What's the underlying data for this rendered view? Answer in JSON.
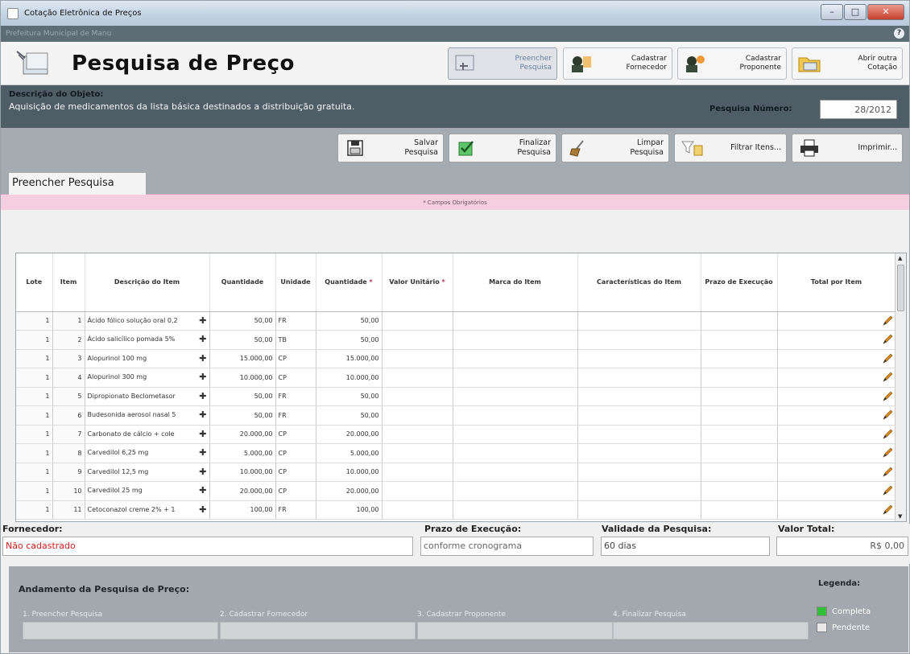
{
  "window": {
    "title": "Cotação Eletrônica de Preços",
    "org": "Prefeitura Municipal de Manu"
  },
  "header": {
    "title": "Pesquisa de Preço",
    "buttons": [
      {
        "l1": "Preencher",
        "l2": "Pesquisa"
      },
      {
        "l1": "Cadastrar",
        "l2": "Fornecedor"
      },
      {
        "l1": "Cadastrar",
        "l2": "Proponente"
      },
      {
        "l1": "Abrir outra",
        "l2": "Cotação"
      }
    ]
  },
  "description": {
    "label": "Descrição do Objeto:",
    "value": "Aquisição de medicamentos da lista básica destinados a distribuição gratuita.",
    "number_label": "Pesquisa Número:",
    "number_value": "28/2012"
  },
  "actions": [
    {
      "l1": "Salvar",
      "l2": "Pesquisa"
    },
    {
      "l1": "Finalizar",
      "l2": "Pesquisa"
    },
    {
      "l1": "Limpar",
      "l2": "Pesquisa"
    },
    {
      "l1": "Filtrar Itens...",
      "l2": ""
    },
    {
      "l1": "Imprimir...",
      "l2": ""
    }
  ],
  "tab": "Preencher Pesquisa",
  "required_note": "* Campos Obrigatórios",
  "grid": {
    "headers": [
      "Lote",
      "Item",
      "Descrição do Item",
      "Quantidade",
      "Unidade",
      "Quantidade",
      "Valor Unitário",
      "Marca do Item",
      "Características do Item",
      "Prazo de Execução",
      "Total por Item"
    ],
    "rows": [
      [
        "1",
        "1",
        "Ácido fólico solução oral 0,2",
        "50,00",
        "FR",
        "50,00"
      ],
      [
        "1",
        "2",
        "Ácido salicílico pomada 5%",
        "50,00",
        "TB",
        "50,00"
      ],
      [
        "1",
        "3",
        "Alopurinol 100 mg",
        "15.000,00",
        "CP",
        "15.000,00"
      ],
      [
        "1",
        "4",
        "Alopurinol 300 mg",
        "10.000,00",
        "CP",
        "10.000,00"
      ],
      [
        "1",
        "5",
        "Dipropionato Beclometasor",
        "50,00",
        "FR",
        "50,00"
      ],
      [
        "1",
        "6",
        "Budesonida aerosol nasal 5",
        "50,00",
        "FR",
        "50,00"
      ],
      [
        "1",
        "7",
        "Carbonato de cálcio + cole",
        "20.000,00",
        "CP",
        "20.000,00"
      ],
      [
        "1",
        "8",
        "Carvedilol 6,25 mg",
        "5.000,00",
        "CP",
        "5.000,00"
      ],
      [
        "1",
        "9",
        "Carvedilol 12,5 mg",
        "10.000,00",
        "CP",
        "10.000,00"
      ],
      [
        "1",
        "10",
        "Carvedilol 25 mg",
        "20.000,00",
        "CP",
        "20.000,00"
      ],
      [
        "1",
        "11",
        "Cetoconazol creme 2% + 1",
        "100,00",
        "FR",
        "100,00"
      ]
    ]
  },
  "fields": {
    "fornecedor_label": "Fornecedor:",
    "fornecedor_value": "Não cadastrado",
    "prazo_label": "Prazo de Execução:",
    "prazo_value": "conforme cronograma",
    "validade_label": "Validade da Pesquisa:",
    "validade_value": "60 dias",
    "total_label": "Valor Total:",
    "total_value": "R$ 0,00"
  },
  "progress": {
    "title": "Andamento da Pesquisa de Preço:",
    "steps": [
      "1. Preencher Pesquisa",
      "2. Cadastrar Fornecedor",
      "3. Cadastrar Proponente",
      "4. Finalizar Pesquisa"
    ],
    "legend_title": "Legenda:",
    "legend": [
      {
        "label": "Completa",
        "color": "#2fbf3a"
      },
      {
        "label": "Pendente",
        "color": "#e8e8e8"
      }
    ]
  }
}
